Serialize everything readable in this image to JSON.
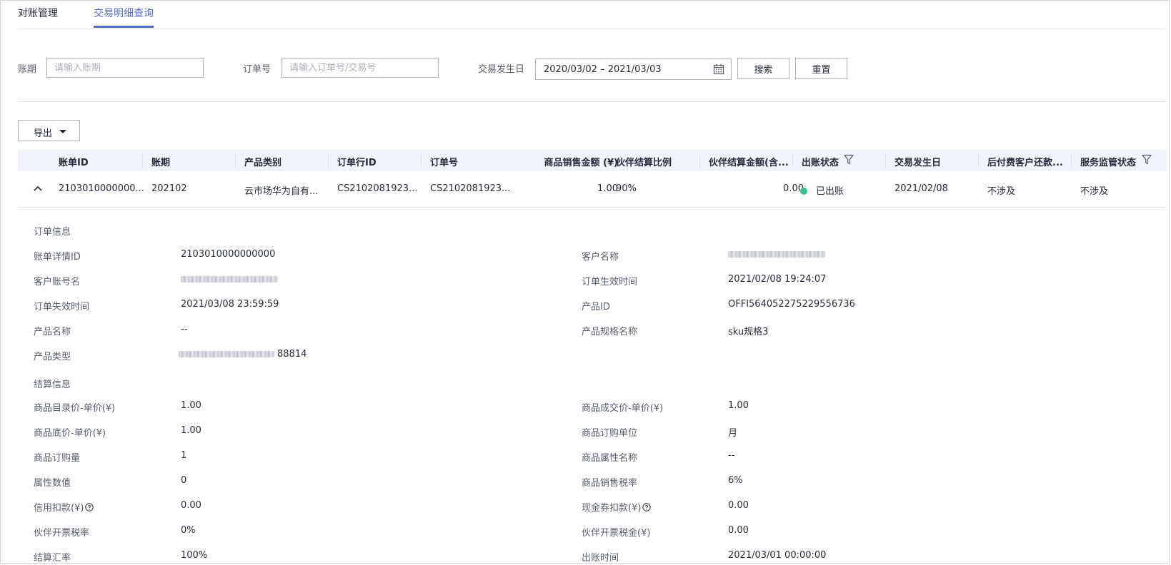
{
  "tabs": [
    {
      "label": "对账管理",
      "active": false
    },
    {
      "label": "交易明细查询",
      "active": true
    }
  ],
  "filters": {
    "bill_period_label": "账期",
    "bill_period_placeholder": "请输入账期",
    "order_no_label": "订单号",
    "order_no_placeholder": "请输入订单号/交易号",
    "trade_date_label": "交易发生日",
    "trade_date_value": "2020/03/02 – 2021/03/03",
    "search_label": "搜索",
    "reset_label": "重置"
  },
  "export": {
    "label": "导出"
  },
  "table": {
    "headers": [
      "账单ID",
      "账期",
      "产品类别",
      "订单行ID",
      "订单号",
      "商品销售金额 (¥)",
      "伙伴结算比例",
      "伙伴结算金额(含...",
      "出账状态",
      "交易发生日",
      "后付费客户还款...",
      "服务监管状态"
    ],
    "row": {
      "bill_id": "2103010000000...",
      "period": "202102",
      "category": "云市场华为自有...",
      "order_line_id": "CS2102081923...",
      "order_no": "CS2102081923...",
      "sales_amount": "1.00",
      "ratio": "90%",
      "settle_amount": "0.00",
      "status": "已出账",
      "trade_date": "2021/02/08",
      "repay": "不涉及",
      "supervision": "不涉及"
    }
  },
  "detail": {
    "order_section": "订单信息",
    "settle_section": "结算信息",
    "order_left": [
      {
        "label": "账单详情ID",
        "value": "2103010000000000"
      },
      {
        "label": "客户账号名",
        "value": ""
      },
      {
        "label": "订单失效时间",
        "value": "2021/03/08 23:59:59"
      },
      {
        "label": "产品名称",
        "value": "--"
      },
      {
        "label": "产品类型",
        "value": "88814"
      }
    ],
    "order_right": [
      {
        "label": "客户名称",
        "value": ""
      },
      {
        "label": "订单生效时间",
        "value": "2021/02/08 19:24:07"
      },
      {
        "label": "产品ID",
        "value": "OFFI564052275229556736"
      },
      {
        "label": "产品规格名称",
        "value": "sku规格3"
      }
    ],
    "settle_left": [
      {
        "label": "商品目录价-单价(¥)",
        "value": "1.00"
      },
      {
        "label": "商品底价-单价(¥)",
        "value": "1.00"
      },
      {
        "label": "商品订购量",
        "value": "1"
      },
      {
        "label": "属性数值",
        "value": "0"
      },
      {
        "label": "信用扣款(¥)",
        "value": "0.00"
      },
      {
        "label": "伙伴开票税率",
        "value": "0%"
      },
      {
        "label": "结算汇率",
        "value": "100%"
      }
    ],
    "settle_right": [
      {
        "label": "商品成交价-单价(¥)",
        "value": "1.00"
      },
      {
        "label": "商品订购单位",
        "value": "月"
      },
      {
        "label": "商品属性名称",
        "value": "--"
      },
      {
        "label": "商品销售税率",
        "value": "6%"
      },
      {
        "label": "现金券扣款(¥)",
        "value": "0.00"
      },
      {
        "label": "伙伴开票税金(¥)",
        "value": "0.00"
      },
      {
        "label": "出账时间",
        "value": "2021/03/01 00:00:00"
      }
    ]
  },
  "colors": {
    "accent": "#526ecc",
    "status_green": "#3ac295"
  }
}
